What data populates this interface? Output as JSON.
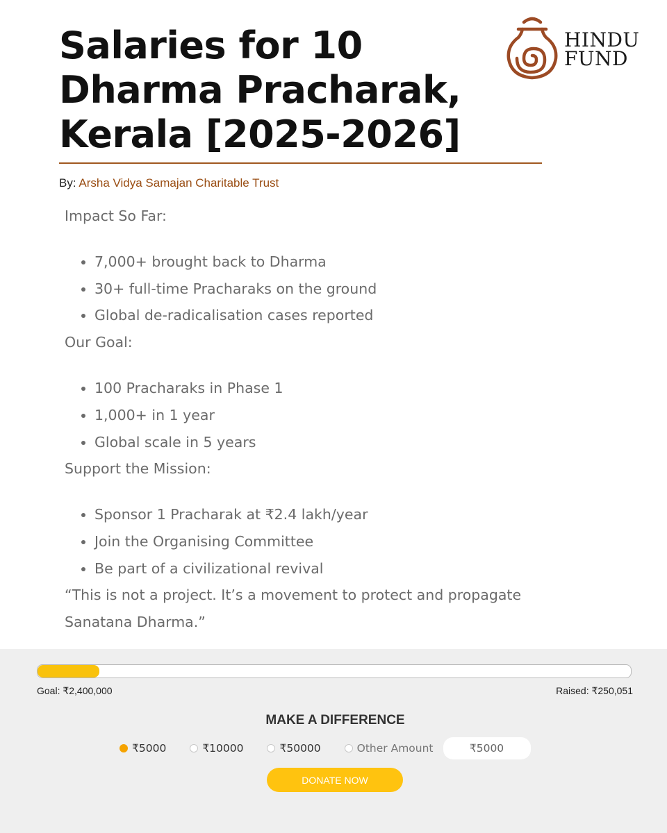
{
  "header": {
    "title": "Salaries for 10 Dharma Pracharak, Kerala [2025-2026]",
    "byline_prefix": "By:",
    "organization": "Arsha Vidya Samajan Charitable Trust"
  },
  "logo": {
    "line1": "HINDU",
    "line2": "FUND",
    "icon": "spiral-pot-icon",
    "color": "#9c4a24"
  },
  "content": {
    "sections": [
      {
        "heading": "Impact So Far:",
        "items": [
          "7,000+ brought back to Dharma",
          "30+ full-time Pracharaks on the ground",
          "Global de-radicalisation cases reported"
        ]
      },
      {
        "heading": "Our Goal:",
        "items": [
          "100 Pracharaks in Phase 1",
          "1,000+ in 1 year",
          "Global scale in 5 years"
        ]
      },
      {
        "heading": "Support the Mission:",
        "items": [
          "Sponsor 1 Pracharak at ₹2.4 lakh/year",
          "Join the Organising Committee",
          "Be part of a civilizational revival"
        ]
      }
    ],
    "quote": "“This is not a project. It’s a movement to protect and propagate Sanatana Dharma.”"
  },
  "funding": {
    "goal_label": "Goal: ₹2,400,000",
    "raised_label": "Raised: ₹250,051",
    "progress_fraction": 0.104,
    "progress_color": "#f9c20c"
  },
  "donate": {
    "heading": "MAKE A DIFFERENCE",
    "options": [
      {
        "label": "₹5000",
        "selected": true
      },
      {
        "label": "₹10000",
        "selected": false
      },
      {
        "label": "₹50000",
        "selected": false
      },
      {
        "label": "Other Amount",
        "selected": false
      }
    ],
    "amount_value": "₹5000",
    "button_label": "DONATE NOW",
    "accent_color": "#ffc30f"
  }
}
